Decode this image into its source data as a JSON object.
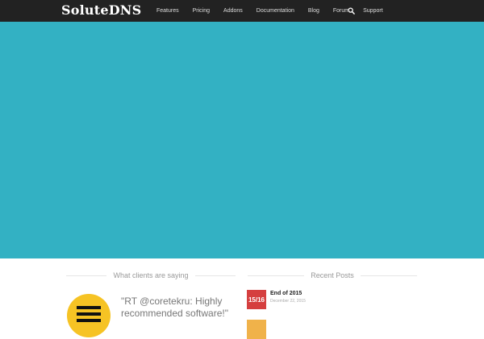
{
  "header": {
    "logo_text": "SoluteDNS",
    "nav": [
      "Features",
      "Pricing",
      "Addons",
      "Documentation",
      "Blog",
      "Forum",
      "Support"
    ]
  },
  "colors": {
    "navbar": "#222222",
    "hero": "#33b1c3",
    "avatar": "#f6c324",
    "post_thumb_1": "#d53f3f",
    "post_thumb_2": "#f0b24a"
  },
  "testimonials": {
    "title": "What clients are saying",
    "quote": "\"RT @coretekru: Highly recommended software!\""
  },
  "recent_posts": {
    "title": "Recent Posts",
    "items": [
      {
        "thumb_text": "15/16",
        "title": "End of 2015",
        "date": "December 22, 2015"
      },
      {
        "thumb_text": "",
        "title": "",
        "date": ""
      }
    ]
  }
}
